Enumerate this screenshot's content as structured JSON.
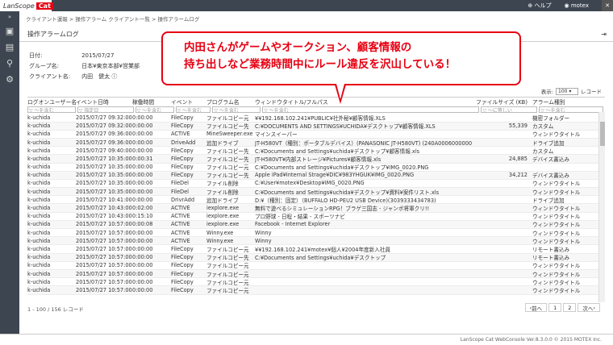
{
  "app": {
    "logo_text": "LanScope",
    "logo_cat": "Cat",
    "help": "ヘルプ",
    "user": "motex"
  },
  "breadcrumb": "クライアント運報 > 操作アラーム クライアント一覧 > 操作アラームログ",
  "page_title": "操作アラームログ",
  "info": {
    "date_label": "日付:",
    "date_value": "2015/07/27",
    "group_label": "グループ名:",
    "group_value": "日本¥東京本部¥営業部",
    "client_label": "クライアント名:",
    "client_value": "内田　健太"
  },
  "callout": {
    "line1": "内田さんがゲームやオークション、顧客情報の",
    "line2": "持ち出しなど業務時間中にルール違反を沢山している！"
  },
  "pager_top": {
    "label": "表示:",
    "value": "100",
    "unit": "レコード"
  },
  "table": {
    "headers": [
      "ログオンユーザー名",
      "イベント日時",
      "稼働時間",
      "イベント",
      "プログラム名",
      "ウィンドウタイトル/フルパス",
      "ファイルサイズ (KB)",
      "アラーム種別"
    ],
    "filters": [
      "▽ ～を含む",
      "▽ 指定日",
      "▽ ～を含む",
      "▽ ～を含む",
      "▽ ～を含む",
      "▽ ～を含む",
      "▽ ～に等しい",
      "▽ ～を含む"
    ],
    "rows": [
      [
        "k-uchida",
        "2015/07/27 09:32:00",
        "0:00:00",
        "FileCopy",
        "ファイルコピー元",
        "¥¥192.168.102.241¥PUBLIC¥社外秘¥顧客情報.XLS",
        "",
        "機密フォルダー"
      ],
      [
        "k-uchida",
        "2015/07/27 09:32:00",
        "0:00:00",
        "FileCopy",
        "ファイルコピー先",
        "C:¥DOCUMENTS AND SETTINGS¥UCHIDA¥デスクトップ¥顧客情報.XLS",
        "55,339",
        "カスタム"
      ],
      [
        "k-uchida",
        "2015/07/27 09:36:00",
        "0:00:00",
        "ACTIVE",
        "MineSweeper.exe",
        "マインスイーパー",
        "",
        "ウィンドウタイトル"
      ],
      [
        "k-uchida",
        "2015/07/27 09:36:00",
        "0:00:00",
        "DriveAdd",
        "追加ドライブ",
        "JT-H580VT（種別：ポータブルデバイス）(PANASONIC JT-H580VT) (240A00060000001)",
        "",
        "ドライブ追加"
      ],
      [
        "k-uchida",
        "2015/07/27 09:40:00",
        "0:00:00",
        "FileCopy",
        "ファイルコピー先",
        "C:¥Documents and Settings¥uchida¥デスクトップ¥顧客情報.xls",
        "",
        "カスタム"
      ],
      [
        "k-uchida",
        "2015/07/27 10:35:00",
        "0:00:31",
        "FileCopy",
        "ファイルコピー先",
        "JT-H580VT¥内部ストレージ¥Pictures¥顧客情報.xls",
        "24,885",
        "デバイス書込み"
      ],
      [
        "k-uchida",
        "2015/07/27 10:35:00",
        "0:00:00",
        "FileCopy",
        "ファイルコピー元",
        "C:¥Documents and Settings¥uchida¥デスクトップ¥IMG_0020.PNG",
        "",
        ""
      ],
      [
        "k-uchida",
        "2015/07/27 10:35:00",
        "0:00:00",
        "FileCopy",
        "ファイルコピー先",
        "Apple iPad¥Internal Strage¥DIC¥983YHGUK¥IMG_0020.PNG",
        "34,212",
        "デバイス書込み"
      ],
      [
        "k-uchida",
        "2015/07/27 10:35:00",
        "0:00:00",
        "FileDel",
        "ファイル削除",
        "C:¥User¥motex¥Desktop¥IMG_0020.PNG",
        "",
        "ウィンドウタイトル"
      ],
      [
        "k-uchida",
        "2015/07/27 10:35:00",
        "0:00:00",
        "FileDel",
        "ファイル削除",
        "C:¥Documents and Settings¥uchida¥デスクトップ¥資料¥案件リスト.xls",
        "",
        "ウィンドウタイトル"
      ],
      [
        "k-uchida",
        "2015/07/27 10:41:00",
        "0:00:00",
        "DrivrAdd",
        "追加ドライブ",
        "D:¥（種別：固定）（BUFFALO HD-PEU2 USB Device)(3039333434783)",
        "",
        "ドライブ追加"
      ],
      [
        "k-uchida",
        "2015/07/27 10:43:00",
        "0:02:00",
        "ACTIVE",
        "iexplore.exe",
        "無料で遊べるシミュレーションRPG！ブラゲ三国志 - ジャンボ将軍クリ!!",
        "",
        "ウィンドウタイトル"
      ],
      [
        "k-uchida",
        "2015/07/27 10:43:00",
        "0:15:10",
        "ACTIVE",
        "iexplore.exe",
        "プロ野球 - 日程・結果 - スポーツナビ",
        "",
        "ウィンドウタイトル"
      ],
      [
        "k-uchida",
        "2015/07/27 10:57:00",
        "0:00:08",
        "ACTIVE",
        "iexplore.exe",
        "Facebook - Internet Explorer",
        "",
        "ウィンドウタイトル"
      ],
      [
        "k-uchida",
        "2015/07/27 10:57:00",
        "0:00:00",
        "ACTIVE",
        "Winny.exe",
        "Winny",
        "",
        "ウィンドウタイトル"
      ],
      [
        "k-uchida",
        "2015/07/27 10:57:00",
        "0:00:00",
        "ACTIVE",
        "Winny.exe",
        "Winny",
        "",
        "ウィンドウタイトル"
      ],
      [
        "k-uchida",
        "2015/07/27 10:57:00",
        "0:00:00",
        "FileCopy",
        "ファイルコピー元",
        "¥¥192.168.102.241¥motex¥個人¥2004年度新入社員",
        "",
        "リモート書込み"
      ],
      [
        "k-uchida",
        "2015/07/27 10:57:00",
        "0:00:00",
        "FileCopy",
        "ファイルコピー先",
        "C:¥Documents and Settings¥uchida¥デスクトップ",
        "",
        "リモート書込み"
      ],
      [
        "k-uchida",
        "2015/07/27 10:57:00",
        "0:00:00",
        "FileCopy",
        "ファイルコピー元",
        "",
        "",
        "ウィンドウタイトル"
      ],
      [
        "k-uchida",
        "2015/07/27 10:57:00",
        "0:00:00",
        "FileCopy",
        "ファイルコピー元",
        "",
        "",
        "ウィンドウタイトル"
      ],
      [
        "k-uchida",
        "2015/07/27 10:57:00",
        "0:00:00",
        "FileCopy",
        "ファイルコピー元",
        "",
        "",
        "ウィンドウタイトル"
      ],
      [
        "k-uchida",
        "2015/07/27 10:57:00",
        "0:00:00",
        "FileCopy",
        "ファイルコピー元",
        "",
        "",
        "ウィンドウタイトル"
      ]
    ]
  },
  "status": "1 - 100 / 156 レコード",
  "pager_bottom": {
    "prev": "前へ",
    "page1": "1",
    "page2": "2",
    "next": "次へ"
  },
  "footer": "LanScope Cat WebConsole Ver.8.3.0.0 © 2015 MOTEX Inc."
}
